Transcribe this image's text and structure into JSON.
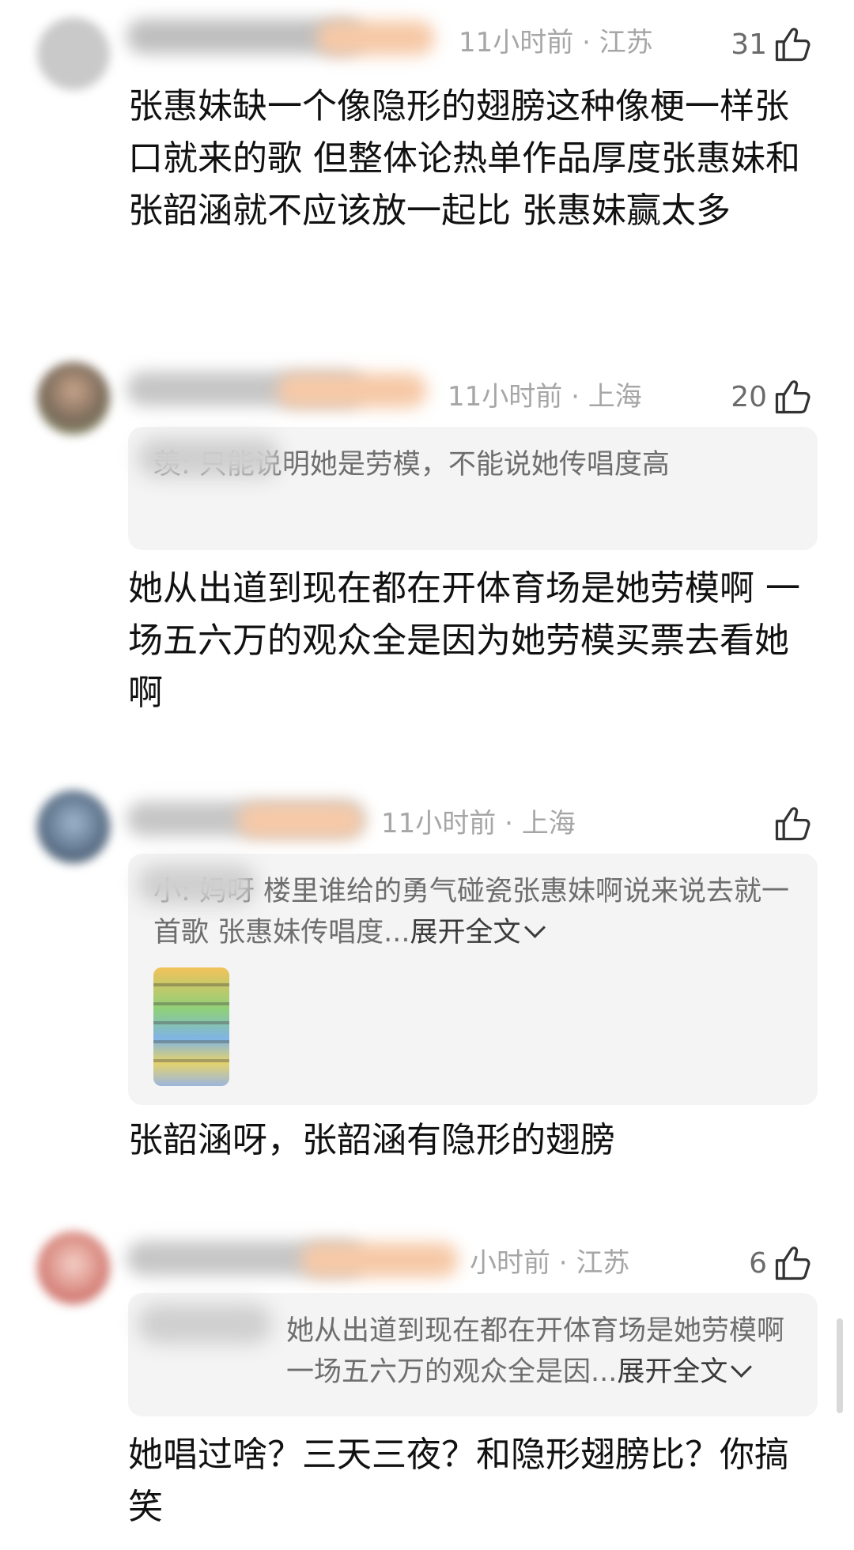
{
  "comments": [
    {
      "time": "11小时前",
      "location": "江苏",
      "likes": "31",
      "text": "张惠妹缺一个像隐形的翅膀这种像梗一样张口就来的歌 但整体论热单作品厚度张惠妹和张韶涵就不应该放一起比 张惠妹赢太多"
    },
    {
      "time": "11小时前",
      "location": "上海",
      "likes": "20",
      "quote": "羡: 只能说明她是劳模，不能说她传唱度高",
      "text": "她从出道到现在都在开体育场是她劳模啊 一场五六万的观众全是因为她劳模买票去看她啊"
    },
    {
      "time": "11小时前",
      "location": "上海",
      "likes": "",
      "quote": "小: 妈呀 楼里谁给的勇气碰瓷张惠妹啊说来说去就一首歌 张惠妹传唱度...",
      "expand_label": "展开全文",
      "text": "张韶涵呀，张韶涵有隐形的翅膀"
    },
    {
      "time": "小时前",
      "location": "江苏",
      "likes": "6",
      "quote": "她从出道到现在都在开体育场是她劳模啊 一场五六万的观众全是因...",
      "expand_label": "展开全文",
      "text": "她唱过啥？三天三夜？和隐形翅膀比？你搞笑"
    }
  ],
  "separator": " · ",
  "icons": {
    "like": "thumbs-up-icon",
    "expand": "chevron-down-icon"
  },
  "colors": {
    "meta": "#a6a6a6",
    "quote_bg": "#f4f4f4",
    "text": "#111111"
  }
}
